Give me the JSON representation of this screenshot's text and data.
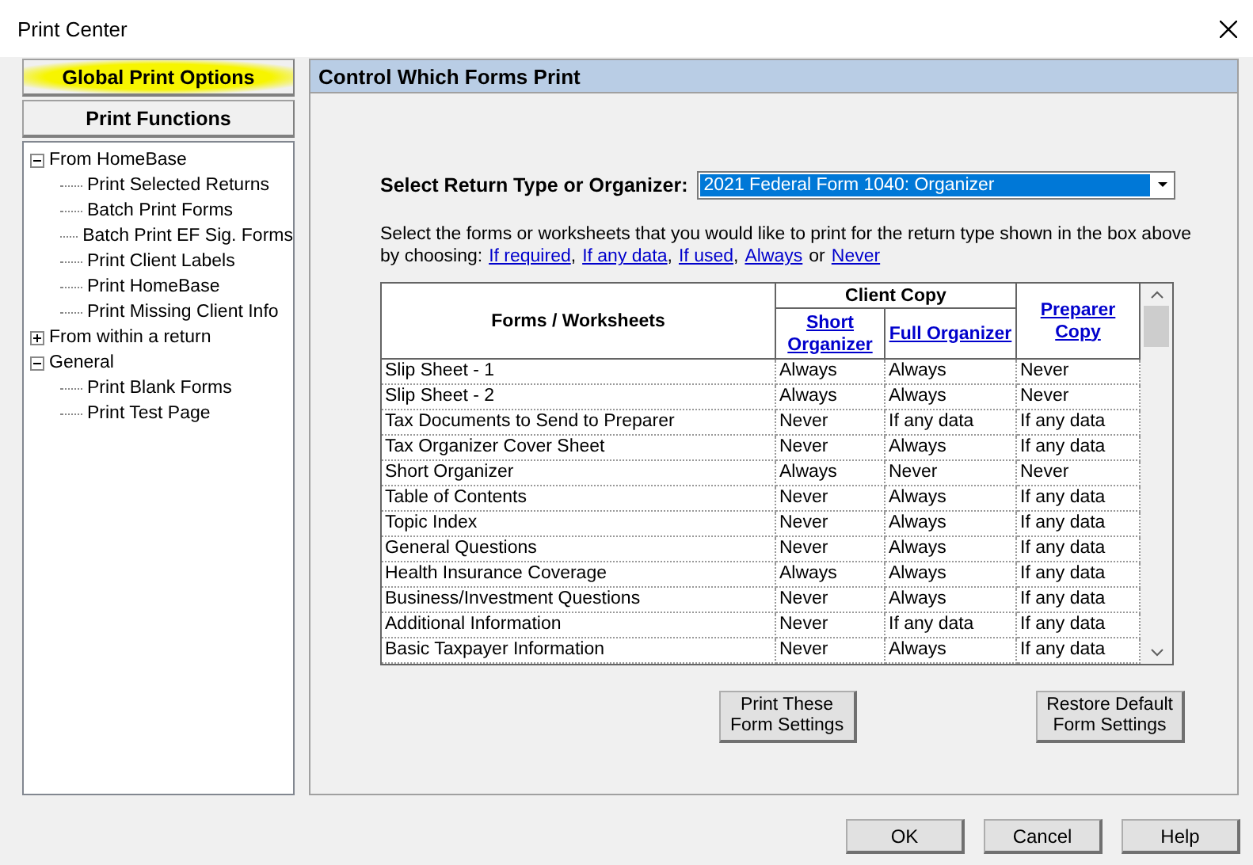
{
  "window": {
    "title": "Print Center"
  },
  "side_buttons": [
    {
      "label": "Global Print Options",
      "highlighted": true
    },
    {
      "label": "Print Functions",
      "highlighted": false
    }
  ],
  "tree": [
    {
      "label": "From HomeBase",
      "expanded": true,
      "children": [
        {
          "label": "Print Selected Returns"
        },
        {
          "label": "Batch Print Forms"
        },
        {
          "label": "Batch Print EF Sig. Forms"
        },
        {
          "label": "Print Client Labels"
        },
        {
          "label": "Print HomeBase"
        },
        {
          "label": "Print Missing Client Info"
        }
      ]
    },
    {
      "label": "From within a return",
      "expanded": false
    },
    {
      "label": "General",
      "expanded": true,
      "children": [
        {
          "label": "Print Blank Forms"
        },
        {
          "label": "Print Test Page"
        }
      ]
    }
  ],
  "panel": {
    "title": "Control Which Forms Print",
    "select_label": "Select Return Type or Organizer:",
    "select_value": "2021 Federal Form 1040: Organizer",
    "instructions": "Select the forms or worksheets that you would like to print for the return type shown in the box above",
    "choose_prefix": "by choosing:",
    "choices": [
      {
        "label": "If required",
        "suffix": ","
      },
      {
        "label": "If any data",
        "suffix": ","
      },
      {
        "label": "If used",
        "suffix": ","
      },
      {
        "label": "Always"
      }
    ],
    "choose_or": "or",
    "last_choice": "Never",
    "table": {
      "group_header": "Client Copy",
      "columns": [
        "Forms / Worksheets",
        "Short Organizer",
        "Full Organizer",
        "Preparer Copy"
      ],
      "rows": [
        [
          "Slip Sheet - 1",
          "Always",
          "Always",
          "Never"
        ],
        [
          "Slip Sheet - 2",
          "Always",
          "Always",
          "Never"
        ],
        [
          "Tax Documents to Send to Preparer",
          "Never",
          "If any data",
          "If any data"
        ],
        [
          "Tax Organizer Cover Sheet",
          "Never",
          "Always",
          "If any data"
        ],
        [
          "Short Organizer",
          "Always",
          "Never",
          "Never"
        ],
        [
          "Table of Contents",
          "Never",
          "Always",
          "If any data"
        ],
        [
          "Topic Index",
          "Never",
          "Always",
          "If any data"
        ],
        [
          "General Questions",
          "Never",
          "Always",
          "If any data"
        ],
        [
          "Health Insurance Coverage",
          "Always",
          "Always",
          "If any data"
        ],
        [
          "Business/Investment Questions",
          "Never",
          "Always",
          "If any data"
        ],
        [
          "Additional Information",
          "Never",
          "If any data",
          "If any data"
        ],
        [
          "Basic Taxpayer Information",
          "Never",
          "Always",
          "If any data"
        ]
      ]
    },
    "buttons": [
      [
        "Print These",
        "Form Settings"
      ],
      [
        "Restore Default",
        "Form Settings"
      ]
    ]
  },
  "footer_buttons": [
    "OK",
    "Cancel",
    "Help"
  ]
}
